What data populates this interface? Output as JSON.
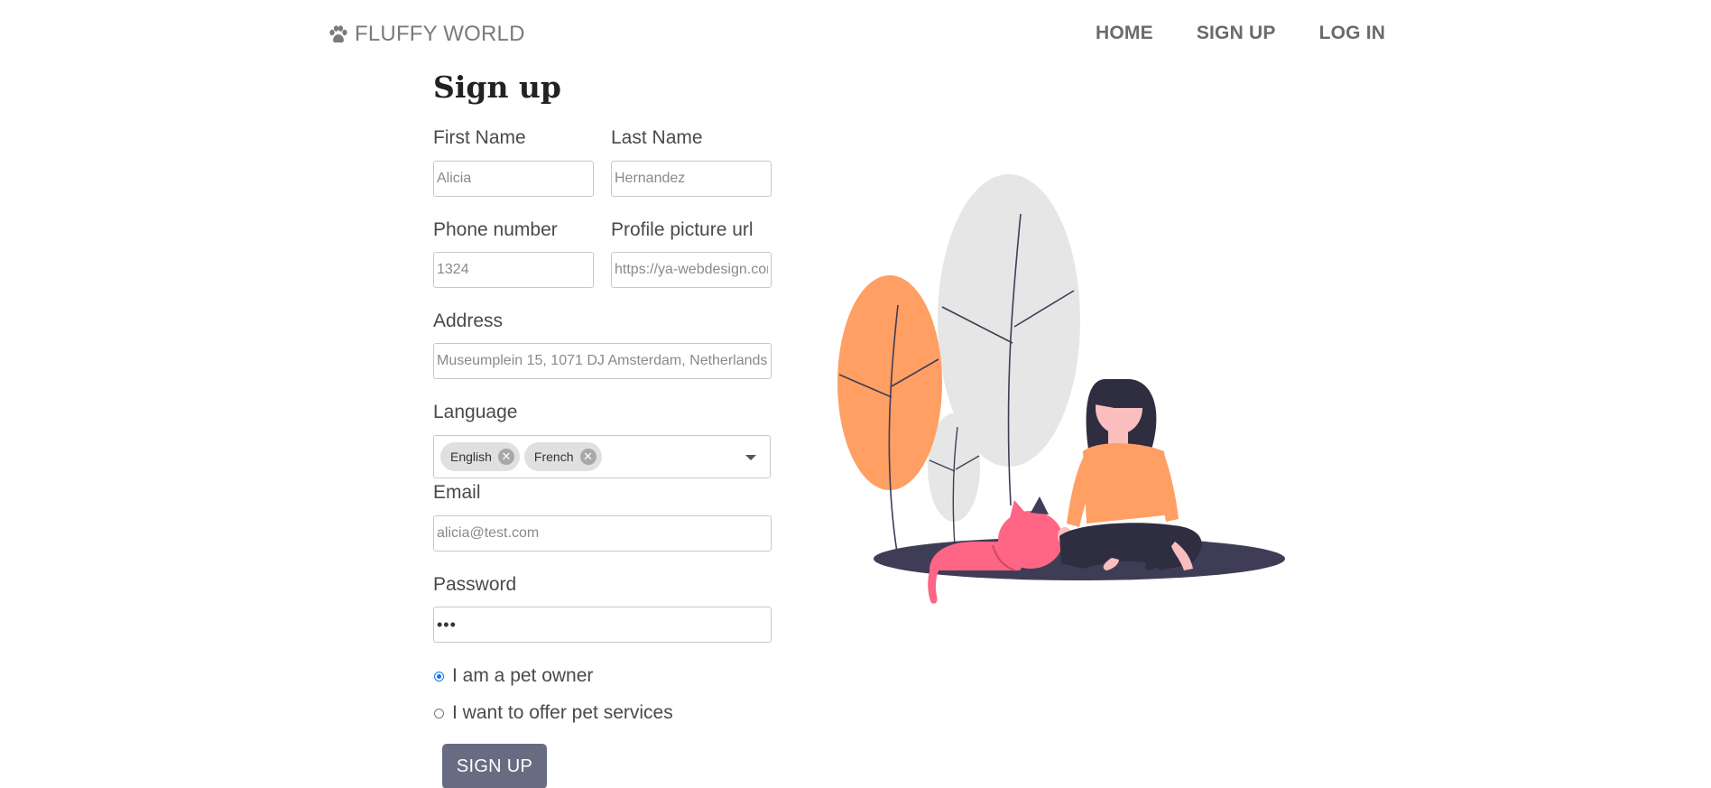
{
  "header": {
    "brand": "FLUFFY WORLD",
    "brand_icon": "paw-icon",
    "nav": [
      "HOME",
      "SIGN UP",
      "LOG IN"
    ]
  },
  "form": {
    "title": "Sign up",
    "first_name": {
      "label": "First Name",
      "value": "Alicia"
    },
    "last_name": {
      "label": "Last Name",
      "value": "Hernandez"
    },
    "phone": {
      "label": "Phone number",
      "value": "1324"
    },
    "profile_picture": {
      "label": "Profile picture url",
      "value": "https://ya-webdesign.com"
    },
    "address": {
      "label": "Address",
      "value": "Museumplein 15, 1071 DJ Amsterdam, Netherlands"
    },
    "language": {
      "label": "Language",
      "selected": [
        "English",
        "French"
      ],
      "remove_icon": "close-circle-icon",
      "dropdown_icon": "caret-down-icon"
    },
    "email": {
      "label": "Email",
      "value": "alicia@test.com"
    },
    "password": {
      "label": "Password",
      "value": "•••"
    },
    "roles": [
      {
        "label": "I am a pet owner",
        "checked": true
      },
      {
        "label": "I want to offer pet services",
        "checked": false
      }
    ],
    "submit": "SIGN UP"
  },
  "colors": {
    "button": "#676c82",
    "accent_orange": "#ff9f64",
    "cat_pink": "#ff6584",
    "ground": "#3f3d56",
    "leaf_gray": "#e6e6e6"
  }
}
